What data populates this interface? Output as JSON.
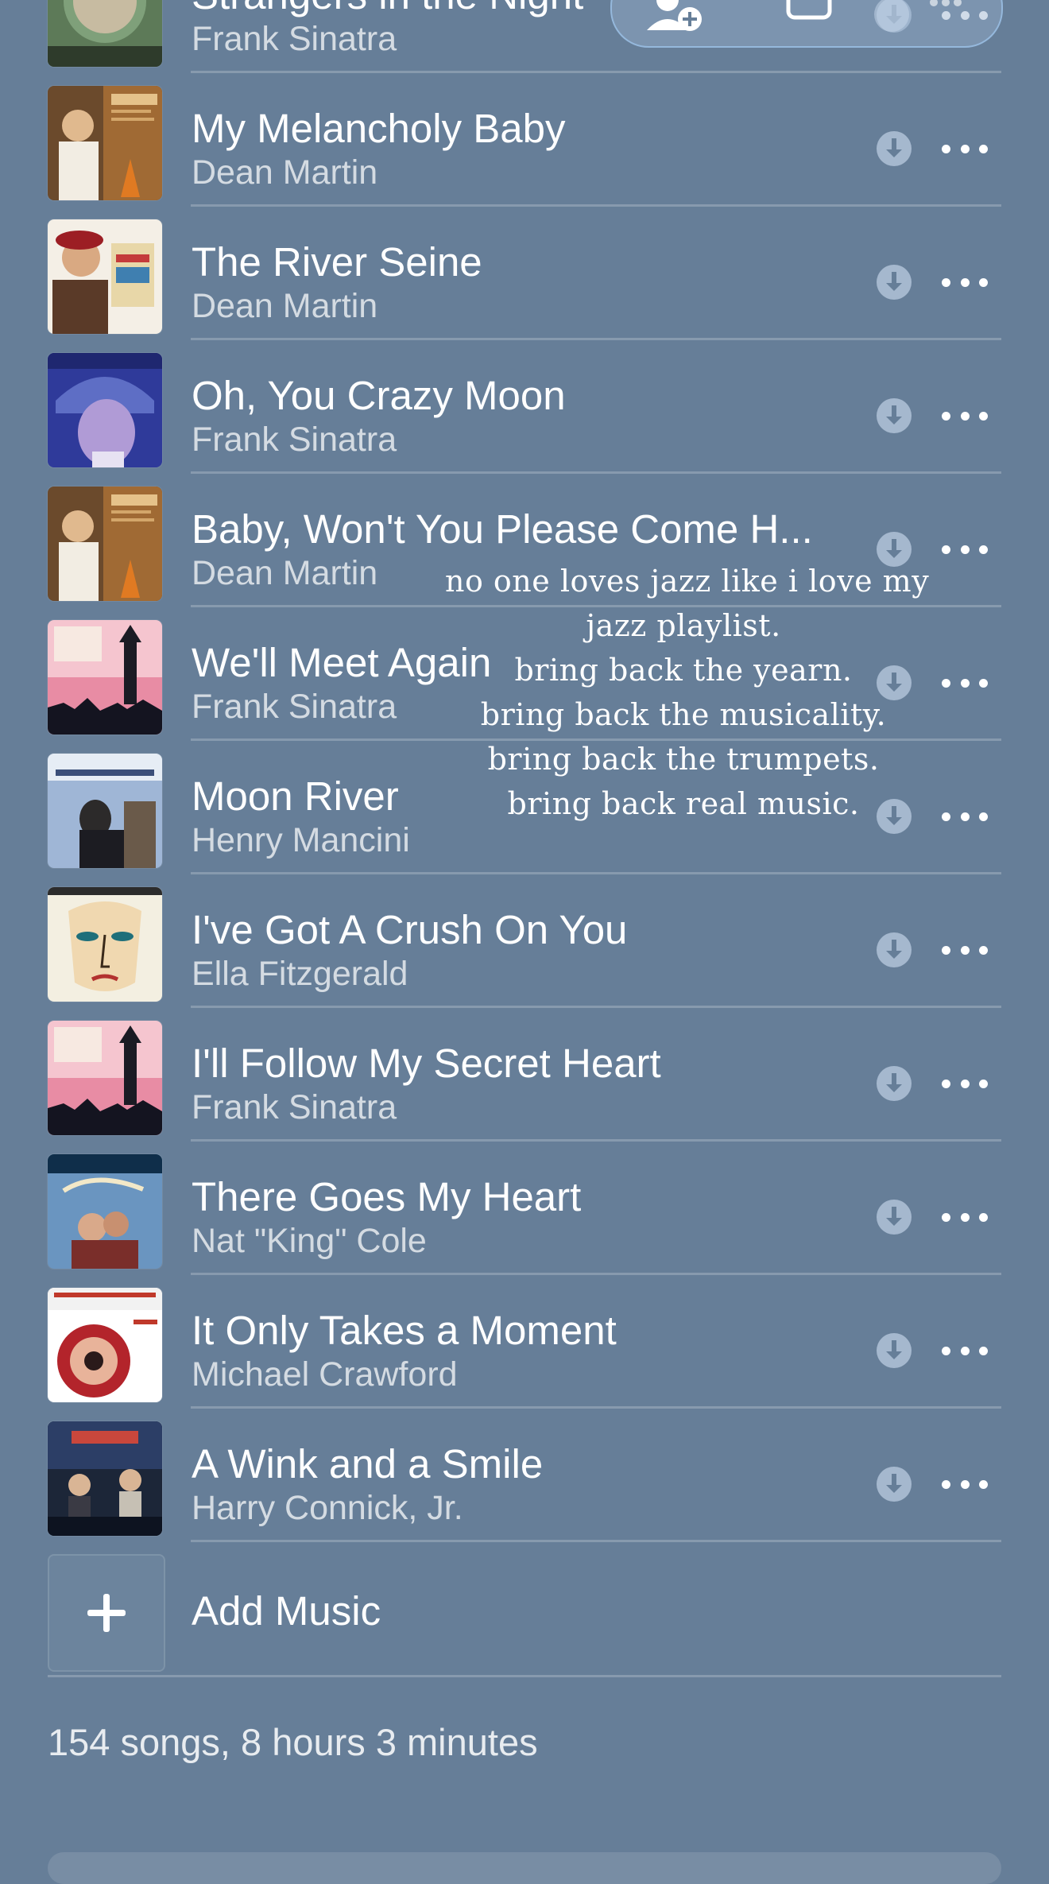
{
  "songs": [
    {
      "title": "Strangers in the Night",
      "artist": "Frank Sinatra",
      "art": "portrait-green"
    },
    {
      "title": "My Melancholy Baby",
      "artist": "Dean Martin",
      "art": "dream-brown"
    },
    {
      "title": "The River Seine",
      "artist": "Dean Martin",
      "art": "french-style"
    },
    {
      "title": "Oh, You Crazy Moon",
      "artist": "Frank Sinatra",
      "art": "moonlight-blue"
    },
    {
      "title": "Baby, Won't You Please Come H...",
      "artist": "Dean Martin",
      "art": "dream-brown"
    },
    {
      "title": "We'll Meet Again",
      "artist": "Frank Sinatra",
      "art": "great-britain"
    },
    {
      "title": "Moon River",
      "artist": "Henry Mancini",
      "art": "breakfast-blue"
    },
    {
      "title": "I've Got A Crush On You",
      "artist": "Ella Fitzgerald",
      "art": "face-sketch"
    },
    {
      "title": "I'll Follow My Secret Heart",
      "artist": "Frank Sinatra",
      "art": "great-britain"
    },
    {
      "title": "There Goes My Heart",
      "artist": "Nat \"King\" Cole",
      "art": "love-blue"
    },
    {
      "title": "It Only Takes a Moment",
      "artist": "Michael Crawford",
      "art": "hello-dolly"
    },
    {
      "title": "A Wink and a Smile",
      "artist": "Harry Connick, Jr.",
      "art": "sleepless"
    }
  ],
  "add_music_label": "Add Music",
  "footer_summary": "154 songs, 8 hours 3 minutes",
  "overlay_lines": [
    "no one loves jazz like i love my",
    "jazz playlist.",
    "bring back the yearn.",
    "bring back the musicality.",
    "bring back the trumpets.",
    "bring back real music."
  ],
  "icons": {
    "download": "download-icon",
    "more": "more-icon",
    "add": "plus-icon",
    "add_person": "add-person-icon",
    "window": "square-icon"
  },
  "colors": {
    "background": "#667e98",
    "text": "#ffffff",
    "secondary": "rgba(255,255,255,0.72)"
  }
}
